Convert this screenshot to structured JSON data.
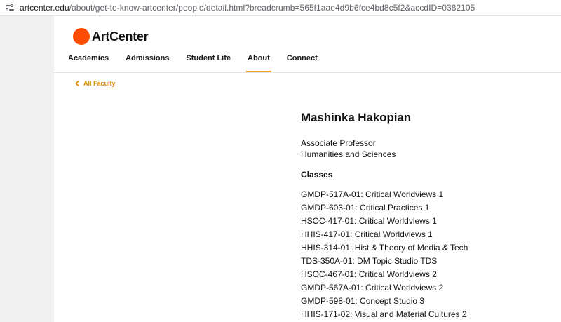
{
  "browser": {
    "url_domain": "artcenter.edu",
    "url_path": "/about/get-to-know-artcenter/people/detail.html?breadcrumb=565f1aae4d9b6fce4bd8c5f2&accdID=0382105"
  },
  "site": {
    "logo_text": "ArtCenter",
    "brand_color": "#fc4c02",
    "accent_color": "#f4a11b"
  },
  "nav": {
    "items": [
      {
        "label": "Academics"
      },
      {
        "label": "Admissions"
      },
      {
        "label": "Student Life"
      },
      {
        "label": "About",
        "active": true
      },
      {
        "label": "Connect"
      }
    ]
  },
  "breadcrumb": {
    "back_label": "All Faculty"
  },
  "profile": {
    "name": "Mashinka Hakopian",
    "title": "Associate Professor",
    "department": "Humanities and Sciences",
    "classes_heading": "Classes",
    "classes": [
      "GMDP-517A-01: Critical Worldviews 1",
      "GMDP-603-01: Critical Practices 1",
      "HSOC-417-01: Critical Worldviews 1",
      "HHIS-417-01: Critical Worldviews 1",
      "HHIS-314-01: Hist & Theory of Media & Tech",
      "TDS-350A-01: DM Topic Studio TDS",
      "HSOC-467-01: Critical Worldviews 2",
      "GMDP-567A-01: Critical Worldviews 2",
      "GMDP-598-01: Concept Studio 3",
      "HHIS-171-02: Visual and Material Cultures 2"
    ]
  }
}
